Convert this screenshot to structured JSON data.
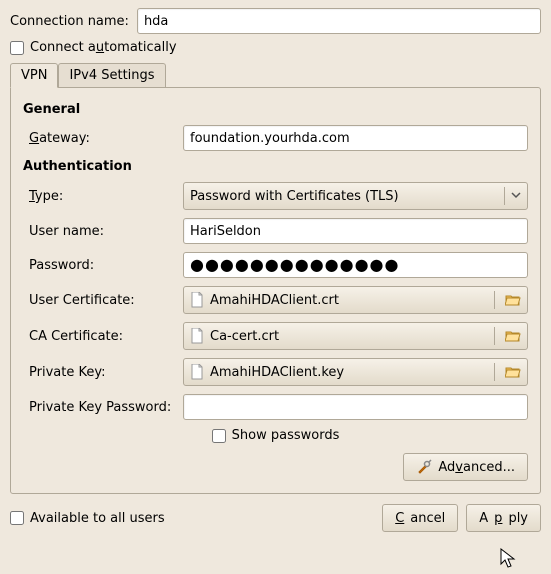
{
  "top": {
    "connection_name_label": "Connection name:",
    "connection_name_value": "hda",
    "connect_auto_pre": "Connect a",
    "connect_auto_u": "u",
    "connect_auto_post": "tomatically"
  },
  "tabs": {
    "vpn": "VPN",
    "ipv4": "IPv4 Settings"
  },
  "general": {
    "title": "General",
    "gateway_pre": "",
    "gateway_u": "G",
    "gateway_post": "ateway:",
    "gateway_value": "foundation.yourhda.com"
  },
  "auth": {
    "title": "Authentication",
    "type_u": "T",
    "type_post": "ype:",
    "type_value": "Password with Certificates (TLS)",
    "username_label": "User name:",
    "username_value": "HariSeldon",
    "password_label": "Password:",
    "password_value": "●●●●●●●●●●●●●●",
    "user_cert_label": "User Certificate:",
    "user_cert_value": "AmahiHDAClient.crt",
    "ca_cert_label": "CA Certificate:",
    "ca_cert_value": "Ca-cert.crt",
    "privkey_label": "Private Key:",
    "privkey_value": "AmahiHDAClient.key",
    "privkey_pw_label": "Private Key Password:",
    "privkey_pw_value": "",
    "show_passwords": "Show passwords",
    "advanced_pre": "Ad",
    "advanced_u": "v",
    "advanced_post": "anced..."
  },
  "footer": {
    "available_all": "Available to all users",
    "cancel_u": "C",
    "cancel_post": "ancel",
    "apply_pre": "A",
    "apply_u": "p",
    "apply_post": "ply"
  }
}
